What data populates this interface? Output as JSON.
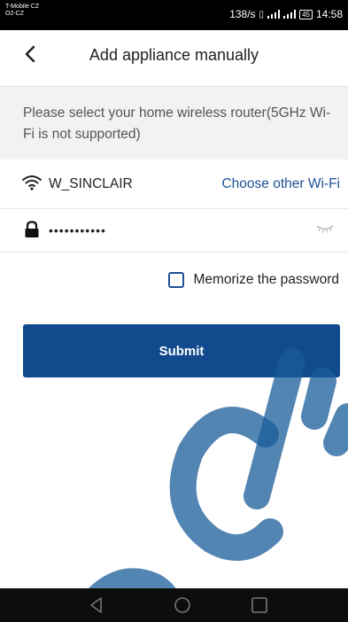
{
  "status_bar": {
    "carrier_line1": "T-Mobile CZ",
    "carrier_line2": "O2-CZ",
    "network_speed": "138/s",
    "battery": "45",
    "time": "14:58"
  },
  "header": {
    "title": "Add appliance manually",
    "back_icon": "chevron-left-icon"
  },
  "info": {
    "text": "Please select your home wireless router(5GHz Wi-Fi is not supported)"
  },
  "wifi": {
    "ssid": "W_SINCLAIR",
    "choose_label": "Choose other Wi-Fi",
    "icon": "wifi-icon",
    "accent_color": "#1d5197"
  },
  "password": {
    "value": "•••••••••••",
    "icon": "lock-icon",
    "toggle_icon": "eye-closed-icon"
  },
  "memorize": {
    "label": "Memorize the password",
    "checked": false
  },
  "submit": {
    "label": "Submit",
    "color": "#114a8d"
  },
  "nav_bar": {
    "back": "nav-back-icon",
    "home": "nav-home-icon",
    "recents": "nav-recents-icon"
  }
}
